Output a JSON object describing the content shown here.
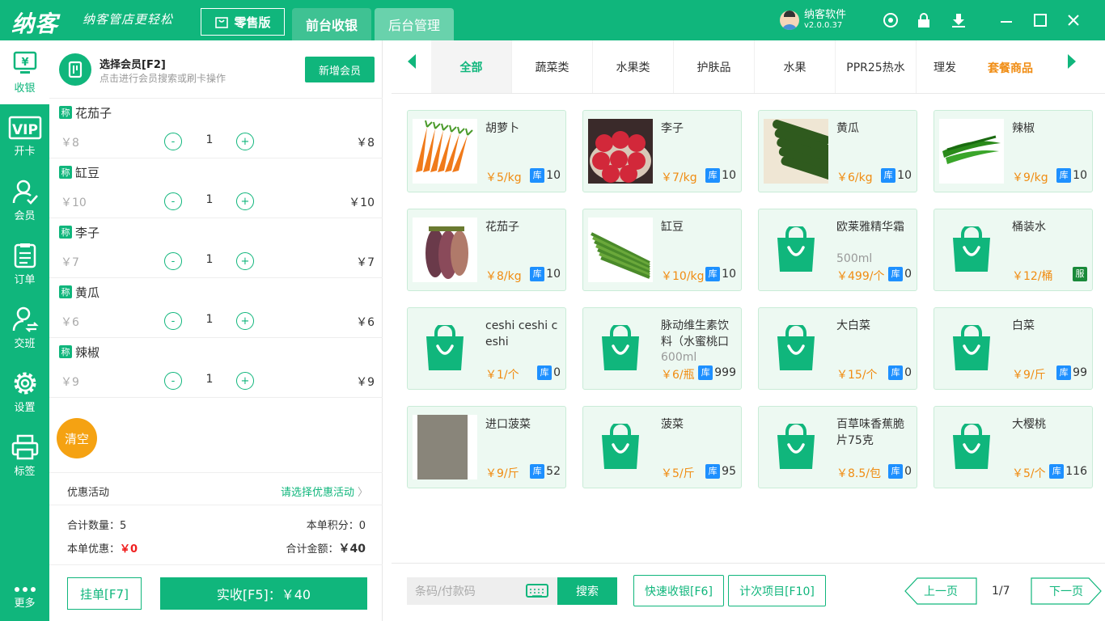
{
  "app": {
    "logo": "纳客",
    "slogan": "纳客管店更轻松",
    "edition": "零售版",
    "tabs": [
      "前台收银",
      "后台管理"
    ],
    "user_name": "纳客软件",
    "version": "v2.0.0.37"
  },
  "sidebar": [
    "收银",
    "开卡",
    "会员",
    "订单",
    "交班",
    "设置",
    "标签",
    "更多"
  ],
  "member": {
    "title": "选择会员[F2]",
    "subtitle": "点击进行会员搜索或刷卡操作",
    "add_button": "新增会员"
  },
  "cart": [
    {
      "tag": "称",
      "name": "花茄子",
      "price": "￥8",
      "qty": "1",
      "total": "￥8"
    },
    {
      "tag": "称",
      "name": "缸豆",
      "price": "￥10",
      "qty": "1",
      "total": "￥10"
    },
    {
      "tag": "称",
      "name": "李子",
      "price": "￥7",
      "qty": "1",
      "total": "￥7"
    },
    {
      "tag": "称",
      "name": "黄瓜",
      "price": "￥6",
      "qty": "1",
      "total": "￥6"
    },
    {
      "tag": "称",
      "name": "辣椒",
      "price": "￥9",
      "qty": "1",
      "total": "￥9"
    }
  ],
  "controls": {
    "minus": "-",
    "plus": "+",
    "clear": "清空"
  },
  "promo": {
    "label": "优惠活动",
    "select": "请选择优惠活动",
    "arrow": "〉"
  },
  "summary": {
    "qty_label": "合计数量：",
    "qty": "5",
    "points_label": "本单积分：",
    "points": "0",
    "discount_label": "本单优惠：",
    "discount": "￥0",
    "total_label": "合计金额：",
    "total": "￥40"
  },
  "actions": {
    "hang": "挂单[F7]",
    "pay": "实收[F5]：￥40"
  },
  "categories": [
    "全部",
    "蔬菜类",
    "水果类",
    "护肤品",
    "水果",
    "PPR25热水",
    "理发"
  ],
  "category_extra": "套餐商品",
  "stock_label": "库",
  "products": [
    {
      "name": "胡萝卜",
      "price": "￥5/kg",
      "stock": "10",
      "img": "carrot"
    },
    {
      "name": "李子",
      "price": "￥7/kg",
      "stock": "10",
      "img": "plum"
    },
    {
      "name": "黄瓜",
      "price": "￥6/kg",
      "stock": "10",
      "img": "cucumber"
    },
    {
      "name": "辣椒",
      "price": "￥9/kg",
      "stock": "10",
      "img": "pepper"
    },
    {
      "name": "花茄子",
      "price": "￥8/kg",
      "stock": "10",
      "img": "eggplant"
    },
    {
      "name": "缸豆",
      "price": "￥10/kg",
      "stock": "10",
      "img": "beans"
    },
    {
      "name": "欧莱雅精华霜",
      "spec": "500ml",
      "price": "￥499/个",
      "stock": "0",
      "img": "bag"
    },
    {
      "name": "桶装水",
      "price": "￥12/桶",
      "stock": "",
      "service": "服",
      "img": "bag"
    },
    {
      "name": "ceshi ceshi ceshi",
      "price": "￥1/个",
      "stock": "0",
      "img": "bag"
    },
    {
      "name": "脉动维生素饮料（水蜜桃口",
      "spec": "600ml",
      "price": "￥6/瓶",
      "stock": "999",
      "img": "bag"
    },
    {
      "name": "大白菜",
      "price": "￥15/个",
      "stock": "0",
      "img": "bag"
    },
    {
      "name": "白菜",
      "price": "￥9/斤",
      "stock": "99",
      "img": "bag"
    },
    {
      "name": "进口菠菜",
      "price": "￥9/斤",
      "stock": "52",
      "img": "photo"
    },
    {
      "name": "菠菜",
      "price": "￥5/斤",
      "stock": "95",
      "img": "bag"
    },
    {
      "name": "百草味香蕉脆片75克",
      "price": "￥8.5/包",
      "stock": "0",
      "img": "bag"
    },
    {
      "name": "大樱桃",
      "price": "￥5/个",
      "stock": "116",
      "img": "bag"
    }
  ],
  "bottom": {
    "scan_placeholder": "条码/付款码",
    "search": "搜索",
    "quick": "快速收银[F6]",
    "count": "计次项目[F10]",
    "prev": "上一页",
    "page": "1/7",
    "next": "下一页"
  },
  "colors": {
    "brand": "#10b67c",
    "orange": "#f08c12",
    "stock_blue": "#1e90ff"
  }
}
